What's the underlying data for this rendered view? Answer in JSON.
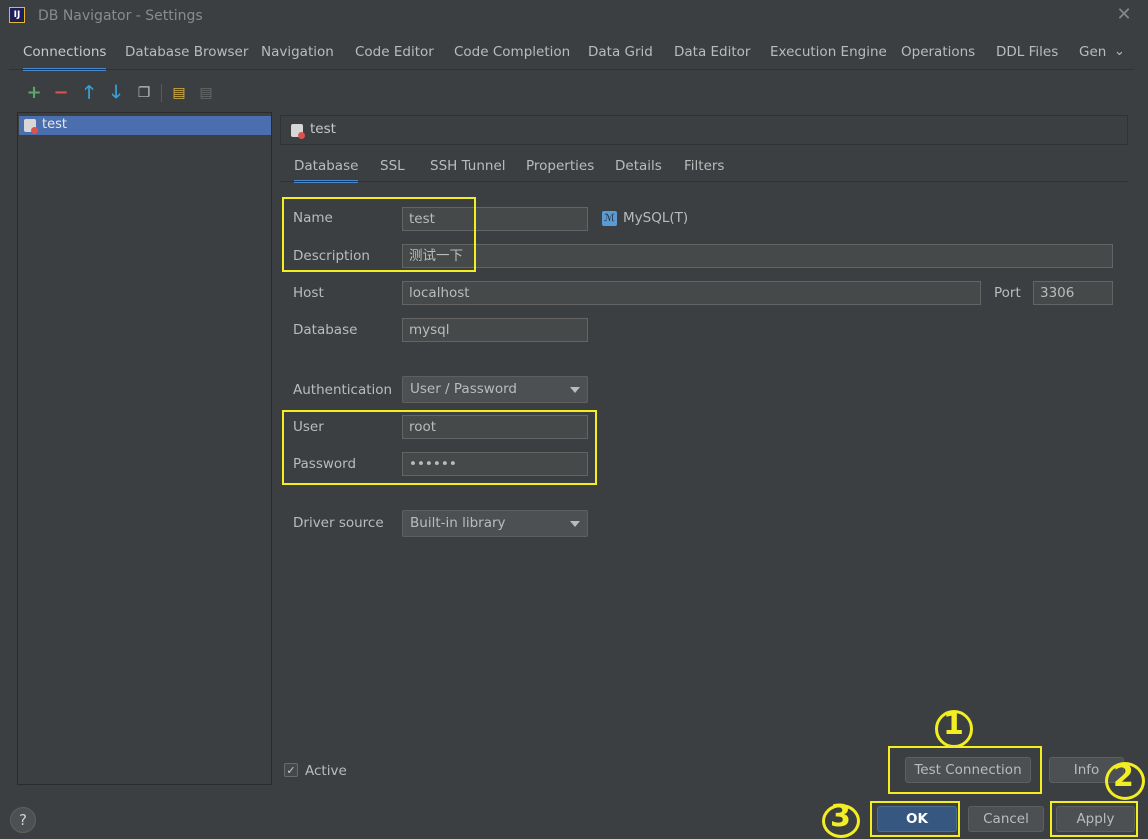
{
  "window": {
    "title": "DB Navigator - Settings"
  },
  "tabs": [
    {
      "label": "Connections"
    },
    {
      "label": "Database Browser"
    },
    {
      "label": "Navigation"
    },
    {
      "label": "Code Editor"
    },
    {
      "label": "Code Completion"
    },
    {
      "label": "Data Grid"
    },
    {
      "label": "Data Editor"
    },
    {
      "label": "Execution Engine"
    },
    {
      "label": "Operations"
    },
    {
      "label": "DDL Files"
    },
    {
      "label": "Gen"
    }
  ],
  "toolbar": {
    "icons": [
      "add-icon",
      "remove-icon",
      "move-up-icon",
      "move-down-icon",
      "copy-icon",
      "paste-icon",
      "duplicate-icon"
    ]
  },
  "connections": [
    {
      "label": "test"
    }
  ],
  "connection_header": {
    "title": "test"
  },
  "sub_tabs": [
    {
      "label": "Database"
    },
    {
      "label": "SSL"
    },
    {
      "label": "SSH Tunnel"
    },
    {
      "label": "Properties"
    },
    {
      "label": "Details"
    },
    {
      "label": "Filters"
    }
  ],
  "form": {
    "name": {
      "label": "Name",
      "value": "test"
    },
    "db_type": "MySQL(T)",
    "description": {
      "label": "Description",
      "value": "测试一下"
    },
    "host": {
      "label": "Host",
      "value": "localhost"
    },
    "port": {
      "label": "Port",
      "value": "3306"
    },
    "database": {
      "label": "Database",
      "value": "mysql"
    },
    "authentication": {
      "label": "Authentication",
      "value": "User / Password"
    },
    "user": {
      "label": "User",
      "value": "root"
    },
    "password": {
      "label": "Password",
      "value": "••••••"
    },
    "driver_source": {
      "label": "Driver source",
      "value": "Built-in library"
    }
  },
  "active": {
    "label": "Active",
    "checked": true
  },
  "buttons": {
    "test_connection": "Test Connection",
    "info": "Info",
    "ok": "OK",
    "cancel": "Cancel",
    "apply": "Apply",
    "help": "?"
  },
  "annotations": {
    "n1": "1",
    "n2": "2",
    "n3": "3"
  },
  "colors": {
    "accent": "#4a88c7",
    "highlight": "#f2ee21",
    "background": "#3c3f41",
    "selection": "#4b6eaf"
  }
}
